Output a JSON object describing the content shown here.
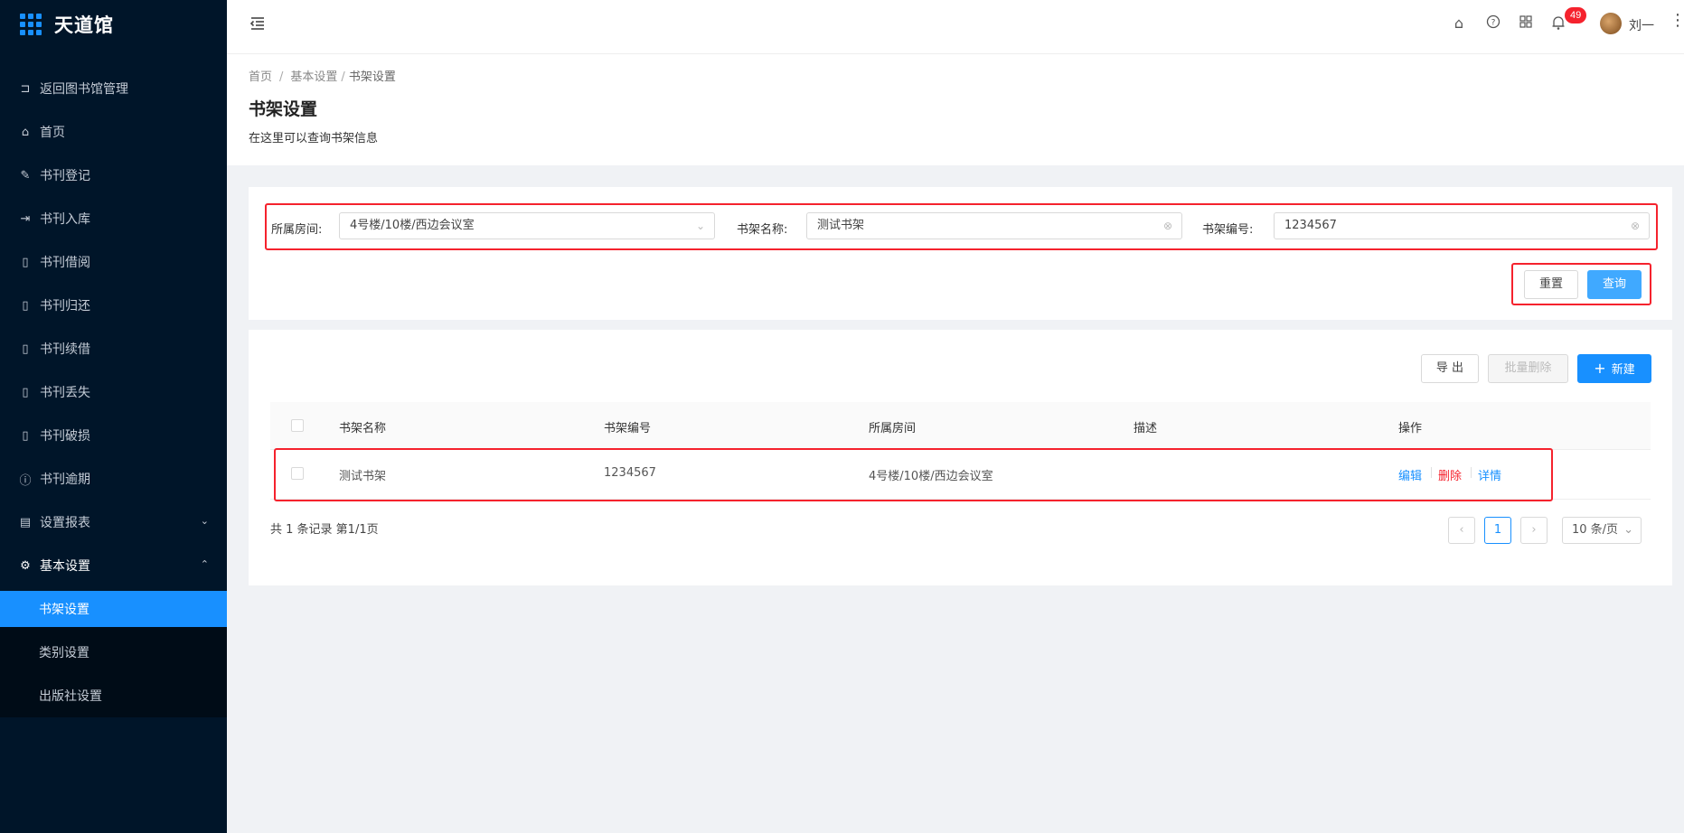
{
  "brand": {
    "title": "天道馆"
  },
  "sidebar": {
    "items": [
      {
        "label": "返回图书馆管理",
        "icon": "return-icon"
      },
      {
        "label": "首页",
        "icon": "home-icon"
      },
      {
        "label": "书刊登记",
        "icon": "pen-icon"
      },
      {
        "label": "书刊入库",
        "icon": "import-icon"
      },
      {
        "label": "书刊借阅",
        "icon": "book-icon"
      },
      {
        "label": "书刊归还",
        "icon": "book-icon"
      },
      {
        "label": "书刊续借",
        "icon": "book-icon"
      },
      {
        "label": "书刊丢失",
        "icon": "book-icon"
      },
      {
        "label": "书刊破损",
        "icon": "book-icon"
      },
      {
        "label": "书刊逾期",
        "icon": "info-circle-icon"
      },
      {
        "label": "设置报表",
        "icon": "report-icon"
      },
      {
        "label": "基本设置",
        "icon": "gear-icon"
      }
    ],
    "submenu": [
      {
        "label": "书架设置"
      },
      {
        "label": "类别设置"
      },
      {
        "label": "出版社设置"
      }
    ]
  },
  "header": {
    "notification_count": "49",
    "username": "刘一"
  },
  "page": {
    "breadcrumb": [
      "首页",
      "基本设置",
      "书架设置"
    ],
    "title": "书架设置",
    "subtitle": "在这里可以查询书架信息"
  },
  "filters": {
    "room_label": "所属房间:",
    "room_value": "4号楼/10楼/西边会议室",
    "name_label": "书架名称:",
    "name_value": "测试书架",
    "code_label": "书架编号:",
    "code_value": "1234567",
    "reset_label": "重置",
    "query_label": "查询"
  },
  "toolbar": {
    "export_label": "导 出",
    "batch_delete_label": "批量删除",
    "new_label": "新建"
  },
  "table": {
    "columns": [
      "书架名称",
      "书架编号",
      "所属房间",
      "描述",
      "操作"
    ],
    "rows": [
      {
        "name": "测试书架",
        "code": "1234567",
        "room": "4号楼/10楼/西边会议室",
        "desc": "",
        "edit": "编辑",
        "delete": "删除",
        "detail": "详情"
      }
    ]
  },
  "pagination": {
    "summary": "共 1 条记录 第1/1页",
    "current_page": "1",
    "page_size": "10 条/页"
  },
  "colors": {
    "primary": "#1890ff",
    "sidebar": "#001529",
    "danger": "#f5222d"
  }
}
